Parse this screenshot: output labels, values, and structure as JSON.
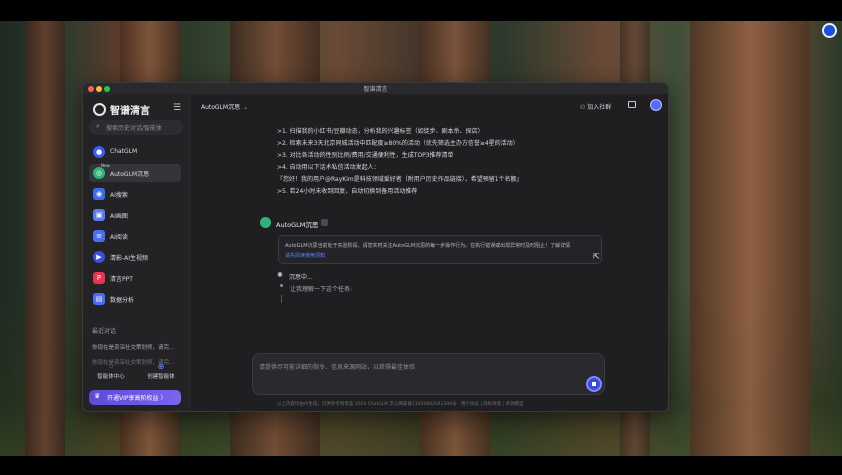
{
  "window": {
    "title": "智谱清言"
  },
  "app": {
    "logo_text": "智谱清言"
  },
  "sidebar": {
    "search_placeholder": "搜索历史对话/智能体",
    "items": [
      {
        "label": "ChatGLM",
        "icon": "chatglm-icon",
        "color": "#3d5afe"
      },
      {
        "label": "AutoGLM沉思",
        "icon": "autoglm-icon",
        "color": "#2fb37a",
        "badge": "New"
      },
      {
        "label": "AI搜索",
        "icon": "ai-search-icon",
        "color": "#3c6cf0"
      },
      {
        "label": "AI画图",
        "icon": "ai-draw-icon",
        "color": "#5a7cf5"
      },
      {
        "label": "AI阅读",
        "icon": "ai-read-icon",
        "color": "#4c6ef5"
      },
      {
        "label": "清影-AI生视频",
        "icon": "video-icon",
        "color": "#3a4ee0"
      },
      {
        "label": "清言PPT",
        "icon": "ppt-icon",
        "color": "#e8344e"
      },
      {
        "label": "数据分析",
        "icon": "data-analysis-icon",
        "color": "#4a6cf7"
      }
    ],
    "recent_title": "最近对话",
    "recent": [
      "你现在是资深社交策划师，请完...",
      "你现在是资深社交策划师，请完..."
    ],
    "agent_center": "智能体中心",
    "create_agent": "创建智能体",
    "vip_label": "开通VIP享高阶权益 〉"
  },
  "header": {
    "model": "AutoGLM沉思",
    "add_community": "加入社群"
  },
  "conversation": {
    "task_lines": [
      ">1. 扫描我的小红书/豆瓣动态，分析我的兴趣标签（如徒步、剧本杀、探店）",
      ">2. 检索未来3天北京同城活动中匹配度≥80%的活动（优先筛选主办方信誉≥4星的活动）",
      ">3. 对比各活动的性别比例/费用/交通便利性，生成TOP3推荐清单",
      ">4. 自动用以下话术私信活动发起人：",
      "『您好！我的用户@RayKim是科技领域爱好者（附用户历史作品链接），希望预留1个名额』",
      ">5. 若24小时未收到回复，自动切换到备用活动推荐"
    ],
    "bot_name": "AutoGLM沉思",
    "notice_text": "AutoGLM沉思当前处于实验阶段。请您实时关注AutoGLM沉思的每一步操作行为。在执行错误或出现异常时及时阻止！了解详情",
    "notice_link": "请先阅读使用须知",
    "thinking_label": "沉思中...",
    "thinking_step": "让我理解一下这个任务:"
  },
  "composer": {
    "placeholder": "请提供尽可能详细的指令、信息来源网站，以获得最佳体验"
  },
  "footer": {
    "text": "以上内容均由AI生成，仅供参考和借鉴   2024 ChatGLM  京公网安备11010802041394号  ·  用户协议 | 隐私政策 | 开源模型"
  }
}
